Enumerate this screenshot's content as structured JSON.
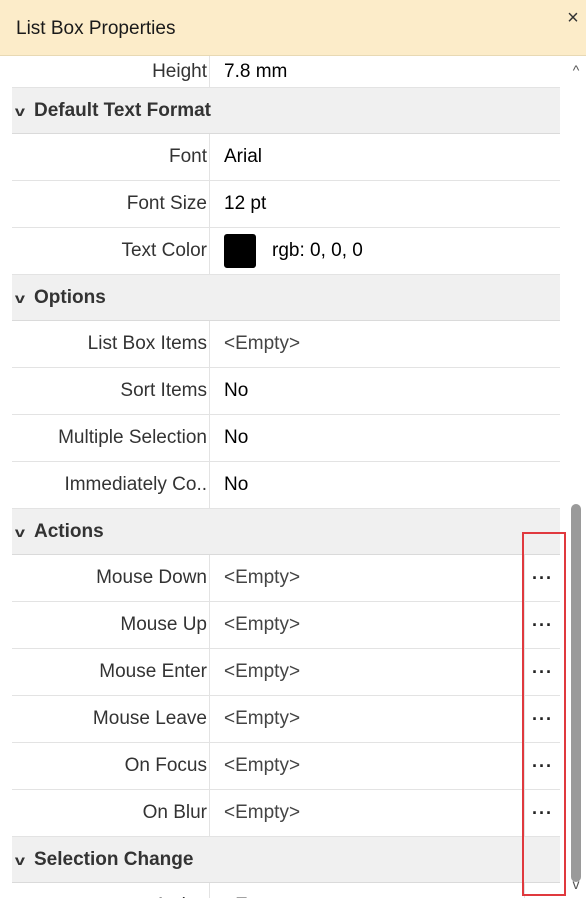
{
  "window": {
    "title": "List Box Properties",
    "close_glyph": "×"
  },
  "rows": {
    "height": {
      "label": "Height",
      "value": "7.8 mm"
    },
    "default_text_format": {
      "title": "Default Text Format"
    },
    "font": {
      "label": "Font",
      "value": "Arial"
    },
    "font_size": {
      "label": "Font Size",
      "value": "12 pt"
    },
    "text_color": {
      "label": "Text Color",
      "value": "rgb: 0, 0, 0",
      "swatch": "#000000"
    },
    "options": {
      "title": "Options"
    },
    "list_box_items": {
      "label": "List Box Items",
      "value": "<Empty>"
    },
    "sort_items": {
      "label": "Sort Items",
      "value": "No"
    },
    "multiple_selection": {
      "label": "Multiple Selection",
      "value": "No"
    },
    "immediately_commit": {
      "label": "Immediately Co..",
      "value": "No"
    },
    "actions": {
      "title": "Actions"
    },
    "mouse_down": {
      "label": "Mouse Down",
      "value": "<Empty>"
    },
    "mouse_up": {
      "label": "Mouse Up",
      "value": "<Empty>"
    },
    "mouse_enter": {
      "label": "Mouse Enter",
      "value": "<Empty>"
    },
    "mouse_leave": {
      "label": "Mouse Leave",
      "value": "<Empty>"
    },
    "on_focus": {
      "label": "On Focus",
      "value": "<Empty>"
    },
    "on_blur": {
      "label": "On Blur",
      "value": "<Empty>"
    },
    "selection_change": {
      "title": "Selection Change"
    },
    "action": {
      "label": "Action",
      "value": "<Empty>"
    }
  },
  "ellipsis": "···",
  "chevron": "v",
  "scroll": {
    "up": "^",
    "down": "v"
  },
  "colors": {
    "title_bg": "#fcecc9",
    "section_bg": "#f0f0f0",
    "highlight": "#e0393e"
  }
}
